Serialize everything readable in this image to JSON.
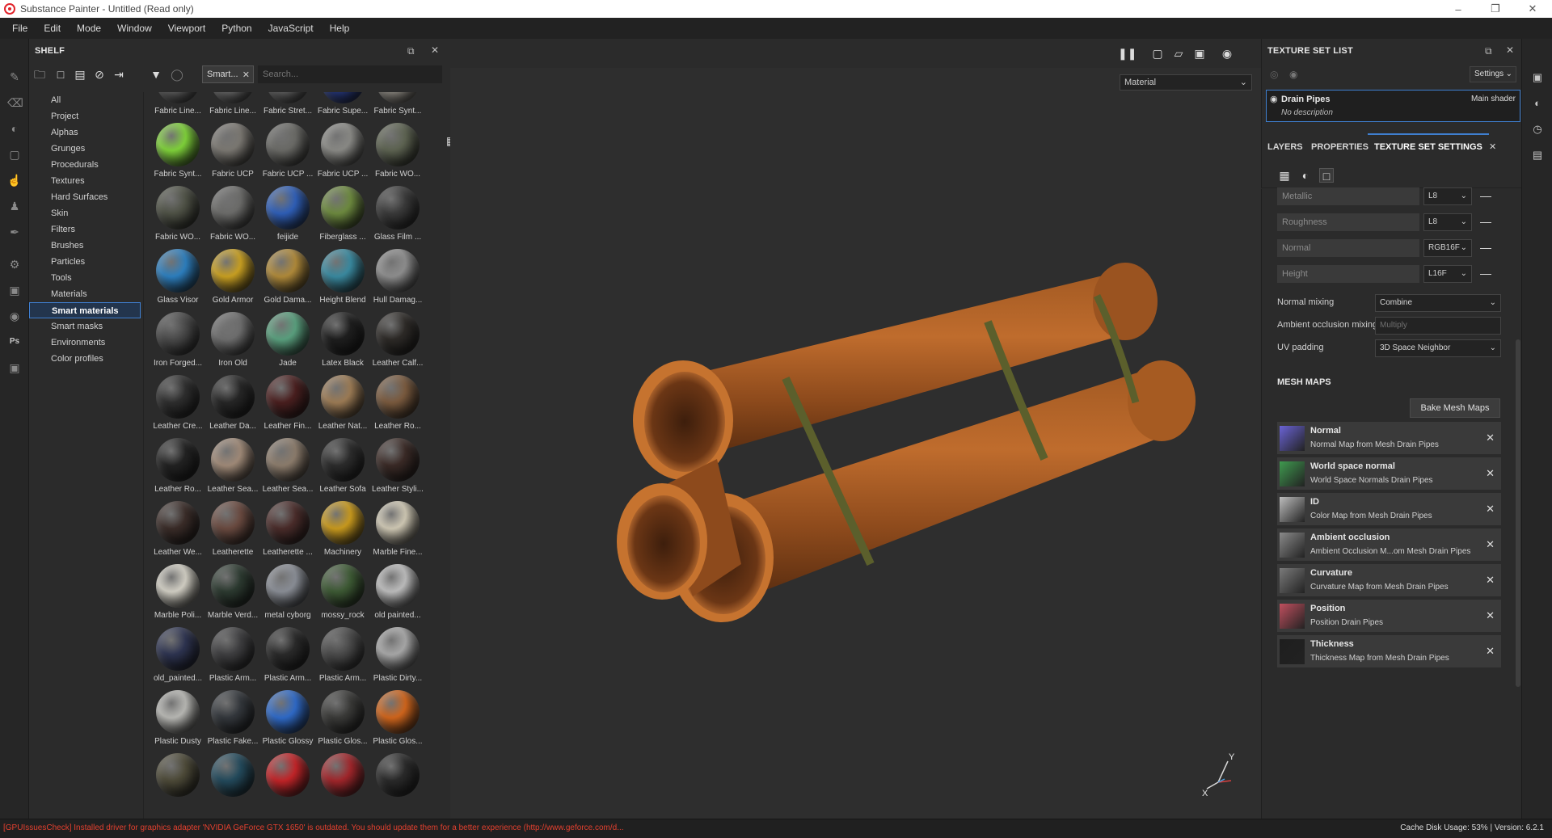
{
  "window": {
    "title": "Substance Painter - Untitled (Read only)",
    "controls": [
      "minimize-icon",
      "maximize-icon",
      "close-icon"
    ]
  },
  "menu": [
    "File",
    "Edit",
    "Mode",
    "Window",
    "Viewport",
    "Python",
    "JavaScript",
    "Help"
  ],
  "shelf": {
    "title": "SHELF",
    "filter_tag": "Smart...",
    "search_placeholder": "Search...",
    "categories": [
      {
        "label": "All",
        "active": false
      },
      {
        "label": "Project",
        "active": false
      },
      {
        "label": "Alphas",
        "active": false
      },
      {
        "label": "Grunges",
        "active": false
      },
      {
        "label": "Procedurals",
        "active": false
      },
      {
        "label": "Textures",
        "active": false
      },
      {
        "label": "Hard Surfaces",
        "active": false
      },
      {
        "label": "Skin",
        "active": false
      },
      {
        "label": "Filters",
        "active": false
      },
      {
        "label": "Brushes",
        "active": false
      },
      {
        "label": "Particles",
        "active": false
      },
      {
        "label": "Tools",
        "active": false
      },
      {
        "label": "Materials",
        "active": false
      },
      {
        "label": "Smart materials",
        "active": true
      },
      {
        "label": "Smart masks",
        "active": false
      },
      {
        "label": "Environments",
        "active": false
      },
      {
        "label": "Color profiles",
        "active": false
      }
    ],
    "materials": [
      {
        "label": "Fabric Line...",
        "color": "#6f6f6f"
      },
      {
        "label": "Fabric Line...",
        "color": "#7a7a7a"
      },
      {
        "label": "Fabric Stret...",
        "color": "#737373"
      },
      {
        "label": "Fabric Supe...",
        "color": "#2b3f8f"
      },
      {
        "label": "Fabric Synt...",
        "color": "#a8a39a"
      },
      {
        "label": "Fabric Synt...",
        "color": "#7fd23a"
      },
      {
        "label": "Fabric UCP",
        "color": "#7b7872"
      },
      {
        "label": "Fabric UCP ...",
        "color": "#6a6a66"
      },
      {
        "label": "Fabric UCP ...",
        "color": "#8a8a86"
      },
      {
        "label": "Fabric WO...",
        "color": "#5d6351"
      },
      {
        "label": "Fabric WO...",
        "color": "#4f5246"
      },
      {
        "label": "Fabric WO...",
        "color": "#6c6c6a"
      },
      {
        "label": "feijide",
        "color": "#2f5fb8"
      },
      {
        "label": "Fiberglass ...",
        "color": "#6d8a3f"
      },
      {
        "label": "Glass Film ...",
        "color": "#3a3a3a"
      },
      {
        "label": "Glass Visor",
        "color": "#2d7fbf"
      },
      {
        "label": "Gold Armor",
        "color": "#c9a022"
      },
      {
        "label": "Gold Dama...",
        "color": "#b08a3a"
      },
      {
        "label": "Height Blend",
        "color": "#3a8aa0"
      },
      {
        "label": "Hull Damag...",
        "color": "#8e8e8e"
      },
      {
        "label": "Iron Forged...",
        "color": "#4a4a4a"
      },
      {
        "label": "Iron Old",
        "color": "#6e6e6e"
      },
      {
        "label": "Jade",
        "color": "#5aa07e"
      },
      {
        "label": "Latex Black",
        "color": "#1e1e1e"
      },
      {
        "label": "Leather Calf...",
        "color": "#2d2a27"
      },
      {
        "label": "Leather Cre...",
        "color": "#2e2e2e"
      },
      {
        "label": "Leather Da...",
        "color": "#262626"
      },
      {
        "label": "Leather Fin...",
        "color": "#4a1f1f"
      },
      {
        "label": "Leather Nat...",
        "color": "#9c7b55"
      },
      {
        "label": "Leather Ro...",
        "color": "#7a5a3e"
      },
      {
        "label": "Leather Ro...",
        "color": "#222222"
      },
      {
        "label": "Leather Sea...",
        "color": "#a08a78"
      },
      {
        "label": "Leather Sea...",
        "color": "#8c7c6c"
      },
      {
        "label": "Leather Sofa",
        "color": "#2c2c2c"
      },
      {
        "label": "Leather Styli...",
        "color": "#3a2a26"
      },
      {
        "label": "Leather We...",
        "color": "#3a2c28"
      },
      {
        "label": "Leatherette",
        "color": "#6a4a40"
      },
      {
        "label": "Leatherette ...",
        "color": "#4a2c2a"
      },
      {
        "label": "Machinery",
        "color": "#c99a1e"
      },
      {
        "label": "Marble Fine...",
        "color": "#cfc8b4"
      },
      {
        "label": "Marble Poli...",
        "color": "#d2cfc4"
      },
      {
        "label": "Marble Verd...",
        "color": "#2c3a30"
      },
      {
        "label": "metal cyborg",
        "color": "#8a8e96"
      },
      {
        "label": "mossy_rock",
        "color": "#3d5a34"
      },
      {
        "label": "old painted...",
        "color": "#bdbdbd"
      },
      {
        "label": "old_painted...",
        "color": "#2d3350"
      },
      {
        "label": "Plastic Arm...",
        "color": "#3e3e40"
      },
      {
        "label": "Plastic Arm...",
        "color": "#2a2a2a"
      },
      {
        "label": "Plastic Arm...",
        "color": "#4a4a4a"
      },
      {
        "label": "Plastic Dirty...",
        "color": "#a8a8a8"
      },
      {
        "label": "Plastic Dusty",
        "color": "#b8b8b4"
      },
      {
        "label": "Plastic Fake...",
        "color": "#33373c"
      },
      {
        "label": "Plastic Glossy",
        "color": "#2f6ac8"
      },
      {
        "label": "Plastic Glos...",
        "color": "#3a3a38"
      },
      {
        "label": "Plastic Glos...",
        "color": "#d0651c"
      },
      {
        "label": "",
        "color": "#4d4a38"
      },
      {
        "label": "",
        "color": "#234a5c"
      },
      {
        "label": "",
        "color": "#c22428"
      },
      {
        "label": "",
        "color": "#a1262b"
      },
      {
        "label": "",
        "color": "#2a2a2a"
      }
    ]
  },
  "viewport": {
    "channel_select": "Material",
    "axis": {
      "y": "Y",
      "x": "X"
    }
  },
  "texture_set_list": {
    "title": "TEXTURE SET LIST",
    "settings_label": "Settings",
    "item": {
      "name": "Drain Pipes",
      "shader": "Main shader",
      "description": "No description"
    }
  },
  "tabs": [
    {
      "label": "LAYERS",
      "active": false
    },
    {
      "label": "PROPERTIES",
      "active": false
    },
    {
      "label": "TEXTURE SET SETTINGS",
      "active": true
    }
  ],
  "texture_set_settings": {
    "channels": [
      {
        "name": "Metallic",
        "format": "L8"
      },
      {
        "name": "Roughness",
        "format": "L8"
      },
      {
        "name": "Normal",
        "format": "RGB16F"
      },
      {
        "name": "Height",
        "format": "L16F"
      }
    ],
    "normal_mixing": {
      "label": "Normal mixing",
      "value": "Combine"
    },
    "ao_mixing": {
      "label": "Ambient occlusion mixing",
      "value": "Multiply"
    },
    "uv_padding": {
      "label": "UV padding",
      "value": "3D Space Neighbor"
    },
    "mesh_maps_title": "MESH MAPS",
    "bake_label": "Bake Mesh Maps",
    "mesh_maps": [
      {
        "name": "Normal",
        "source": "Normal Map from Mesh Drain Pipes",
        "thumb": "#6a63d6"
      },
      {
        "name": "World space normal",
        "source": "World Space Normals Drain Pipes",
        "thumb": "#3f9a4f"
      },
      {
        "name": "ID",
        "source": "Color Map from Mesh Drain Pipes",
        "thumb": "#bdbdbd"
      },
      {
        "name": "Ambient occlusion",
        "source": "Ambient Occlusion M...om Mesh Drain Pipes",
        "thumb": "#8a8a8a"
      },
      {
        "name": "Curvature",
        "source": "Curvature Map from Mesh Drain Pipes",
        "thumb": "#7a7a7a"
      },
      {
        "name": "Position",
        "source": "Position Drain Pipes",
        "thumb": "#c04f5e"
      },
      {
        "name": "Thickness",
        "source": "Thickness Map from Mesh Drain Pipes",
        "thumb": "#1e1e1e"
      }
    ]
  },
  "status": {
    "message": "[GPUIssuesCheck] Installed driver for graphics adapter 'NVIDIA GeForce GTX 1650' is outdated. You should update them for a better experience (http://www.geforce.com/d...",
    "right": "Cache Disk Usage:     53% | Version: 6.2.1"
  }
}
